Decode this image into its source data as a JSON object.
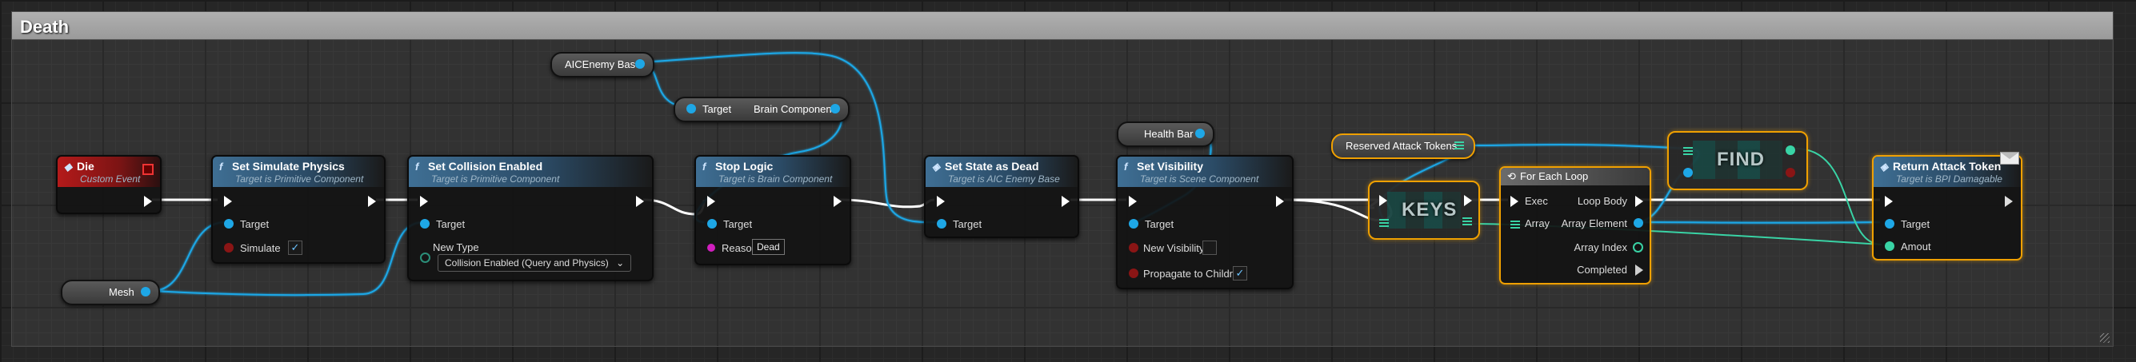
{
  "comment": {
    "title": "Death"
  },
  "nodes": {
    "die": {
      "title": "Die",
      "subtitle": "Custom Event"
    },
    "set_simulate_physics": {
      "title": "Set Simulate Physics",
      "subtitle": "Target is Primitive Component",
      "target_label": "Target",
      "simulate_label": "Simulate",
      "simulate_checked": "✓"
    },
    "set_collision_enabled": {
      "title": "Set Collision Enabled",
      "subtitle": "Target is Primitive Component",
      "target_label": "Target",
      "new_type_label": "New Type",
      "new_type_value": "Collision Enabled (Query and Physics)"
    },
    "stop_logic": {
      "title": "Stop Logic",
      "subtitle": "Target is Brain Component",
      "target_label": "Target",
      "reason_label": "Reason",
      "reason_value": "Dead"
    },
    "set_state_dead": {
      "title": "Set State as Dead",
      "subtitle": "Target is AIC Enemy Base",
      "target_label": "Target"
    },
    "set_visibility": {
      "title": "Set Visibility",
      "subtitle": "Target is Scene Component",
      "target_label": "Target",
      "new_visibility_label": "New Visibility",
      "propagate_label": "Propagate to Children",
      "propagate_checked": "✓"
    },
    "for_each_loop": {
      "title": "For Each Loop",
      "exec_label": "Exec",
      "array_label": "Array",
      "loop_body_label": "Loop Body",
      "array_element_label": "Array Element",
      "array_index_label": "Array Index",
      "completed_label": "Completed"
    },
    "return_attack_token": {
      "title": "Return Attack Token",
      "subtitle": "Target is BPI Damagable",
      "target_label": "Target",
      "amount_label": "Amout"
    },
    "keys": {
      "label": "KEYS"
    },
    "find": {
      "label": "FIND"
    },
    "brain_component": {
      "target_label": "Target",
      "output_label": "Brain Component"
    }
  },
  "variables": {
    "aic_enemy_base": "AICEnemy Base",
    "health_bar": "Health Bar",
    "mesh": "Mesh",
    "reserved_attack_tokens": "Reserved Attack Tokens"
  },
  "colors": {
    "object_pin": "#1ea7e6",
    "bool_pin": "#8a1515",
    "int_pin": "#39d3a5",
    "name_pin": "#d11fbf",
    "selection": "#f0a000",
    "function_header": "#3f6f94",
    "event_header": "#b41a1a"
  }
}
